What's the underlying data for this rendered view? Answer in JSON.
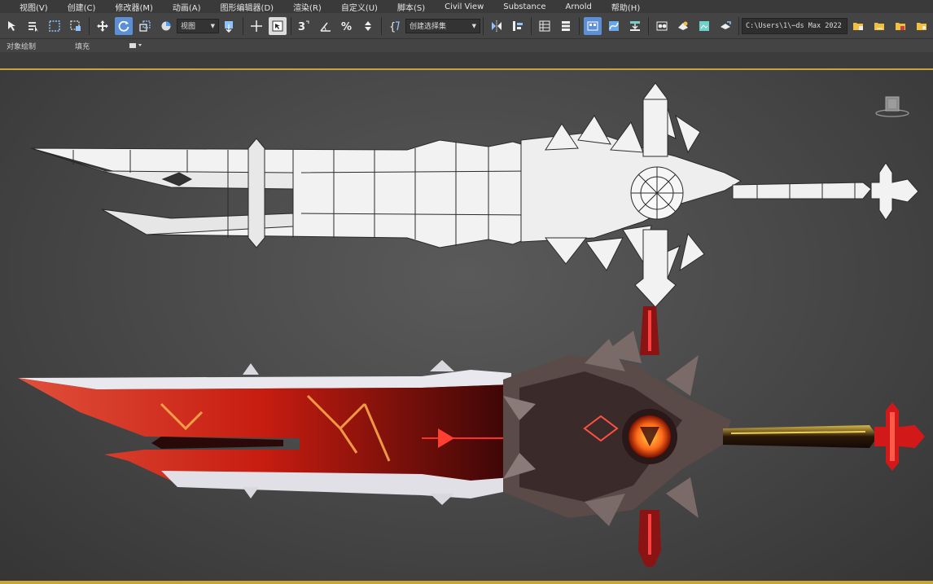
{
  "menubar": {
    "items": [
      {
        "label": "视图(V)"
      },
      {
        "label": "创建(C)"
      },
      {
        "label": "修改器(M)"
      },
      {
        "label": "动画(A)"
      },
      {
        "label": "图形编辑器(D)"
      },
      {
        "label": "渲染(R)"
      },
      {
        "label": "自定义(U)"
      },
      {
        "label": "脚本(S)"
      },
      {
        "label": "Civil View"
      },
      {
        "label": "Substance"
      },
      {
        "label": "Arnold"
      },
      {
        "label": "帮助(H)"
      }
    ]
  },
  "toolbar": {
    "reference_coord": "视图",
    "selection_set": "创建选择集",
    "project_path": "C:\\Users\\1\\⋯ds Max 2022",
    "accent_color": "#5b8fd6"
  },
  "ribbon": {
    "tab_object_paint": "对象绘制",
    "tab_fill": "填充"
  },
  "viewport": {
    "border_color": "#c9a43a",
    "background": "#4a4a4a"
  }
}
